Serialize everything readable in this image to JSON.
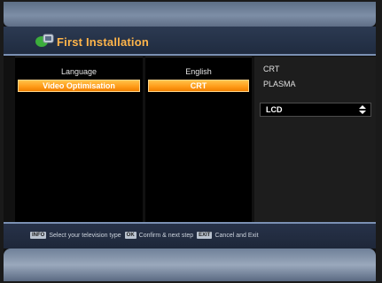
{
  "title": "First Installation",
  "left_column": {
    "items": [
      {
        "label": "Language",
        "selected": false
      },
      {
        "label": "Video Optimisation",
        "selected": true
      }
    ]
  },
  "middle_column": {
    "items": [
      {
        "label": "English",
        "selected": false
      },
      {
        "label": "CRT",
        "selected": true
      }
    ]
  },
  "right_column": {
    "options": [
      "CRT",
      "PLASMA"
    ],
    "current_value": "LCD"
  },
  "help": {
    "info_key": "INFO",
    "info_text": "Select your television type",
    "ok_key": "OK",
    "ok_text": "Confirm & next step",
    "exit_key": "EXIT",
    "exit_text": "Cancel and Exit"
  },
  "colors": {
    "accent_orange": "#ff9d1a",
    "title_orange": "#ffb54a",
    "blue_bar": "#7b90b3"
  },
  "icons": {
    "title_icon": "setup-wizard-icon",
    "spin_icon": "up-down-arrows-icon"
  }
}
